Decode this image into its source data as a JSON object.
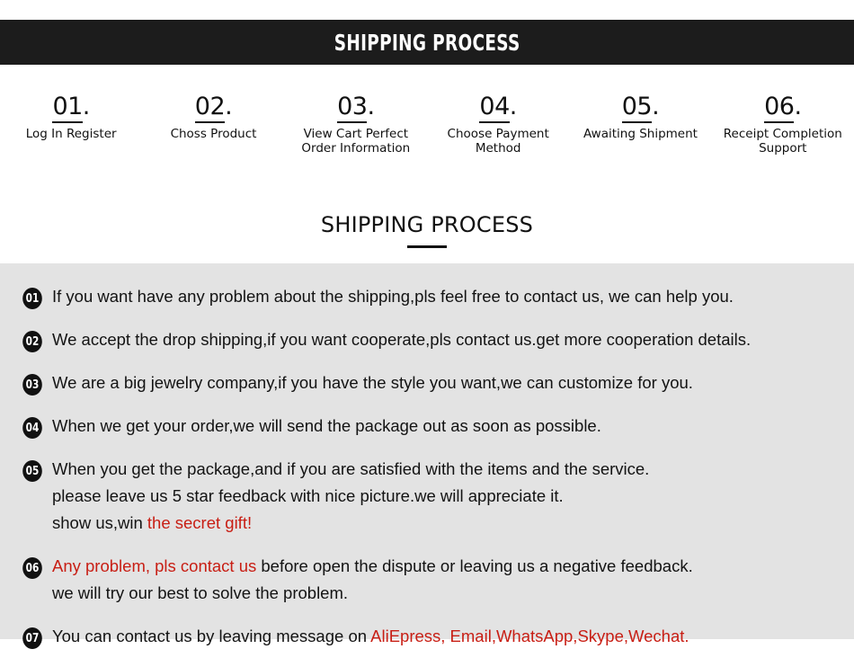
{
  "banner": {
    "title": "SHIPPING PROCESS"
  },
  "steps": [
    {
      "number": "01",
      "dot": ".",
      "label": "Log In Register"
    },
    {
      "number": "02",
      "dot": ".",
      "label": "Choss Product"
    },
    {
      "number": "03",
      "dot": ".",
      "label": "View Cart Perfect\nOrder Information"
    },
    {
      "number": "04",
      "dot": ".",
      "label": "Choose Payment\nMethod"
    },
    {
      "number": "05",
      "dot": ".",
      "label": "Awaiting Shipment"
    },
    {
      "number": "06",
      "dot": ".",
      "label": "Receipt Completion\nSupport"
    }
  ],
  "section": {
    "title": "SHIPPING PROCESS"
  },
  "notes": [
    {
      "badge": "01",
      "lines": [
        [
          {
            "text": "If you want have any problem about the shipping,pls feel free to contact us, we can help you.",
            "color": "black"
          }
        ]
      ]
    },
    {
      "badge": "02",
      "lines": [
        [
          {
            "text": "We accept the drop shipping,if you want cooperate,pls contact us.get more cooperation details.",
            "color": "black"
          }
        ]
      ]
    },
    {
      "badge": "03",
      "lines": [
        [
          {
            "text": "We are a big jewelry company,if you have the style you want,we can customize for you.",
            "color": "black"
          }
        ]
      ]
    },
    {
      "badge": "04",
      "lines": [
        [
          {
            "text": "When we get your order,we will send the package out as soon as possible.",
            "color": "black"
          }
        ]
      ]
    },
    {
      "badge": "05",
      "lines": [
        [
          {
            "text": "When you get the package,and if you are satisfied with the items and the service.",
            "color": "black"
          }
        ],
        [
          {
            "text": "please leave us 5 star feedback with nice picture.we will appreciate it.",
            "color": "black"
          }
        ],
        [
          {
            "text": "show us,win ",
            "color": "black"
          },
          {
            "text": "the secret gift!",
            "color": "red"
          }
        ]
      ]
    },
    {
      "badge": "06",
      "lines": [
        [
          {
            "text": "Any problem, pls contact us",
            "color": "red"
          },
          {
            "text": " before open the dispute or leaving us a negative feedback.",
            "color": "black"
          }
        ],
        [
          {
            "text": "we will try our best to solve the problem.",
            "color": "black"
          }
        ]
      ]
    },
    {
      "badge": "07",
      "lines": [
        [
          {
            "text": "You can contact us by leaving message on ",
            "color": "black"
          },
          {
            "text": "AliEpress, Email,WhatsApp,Skype,Wechat.",
            "color": "red"
          }
        ]
      ]
    }
  ],
  "colors": {
    "banner_bg": "#1c1c1c",
    "panel_bg": "#e3e3e3",
    "accent_red": "#c81e14",
    "text": "#131313"
  }
}
